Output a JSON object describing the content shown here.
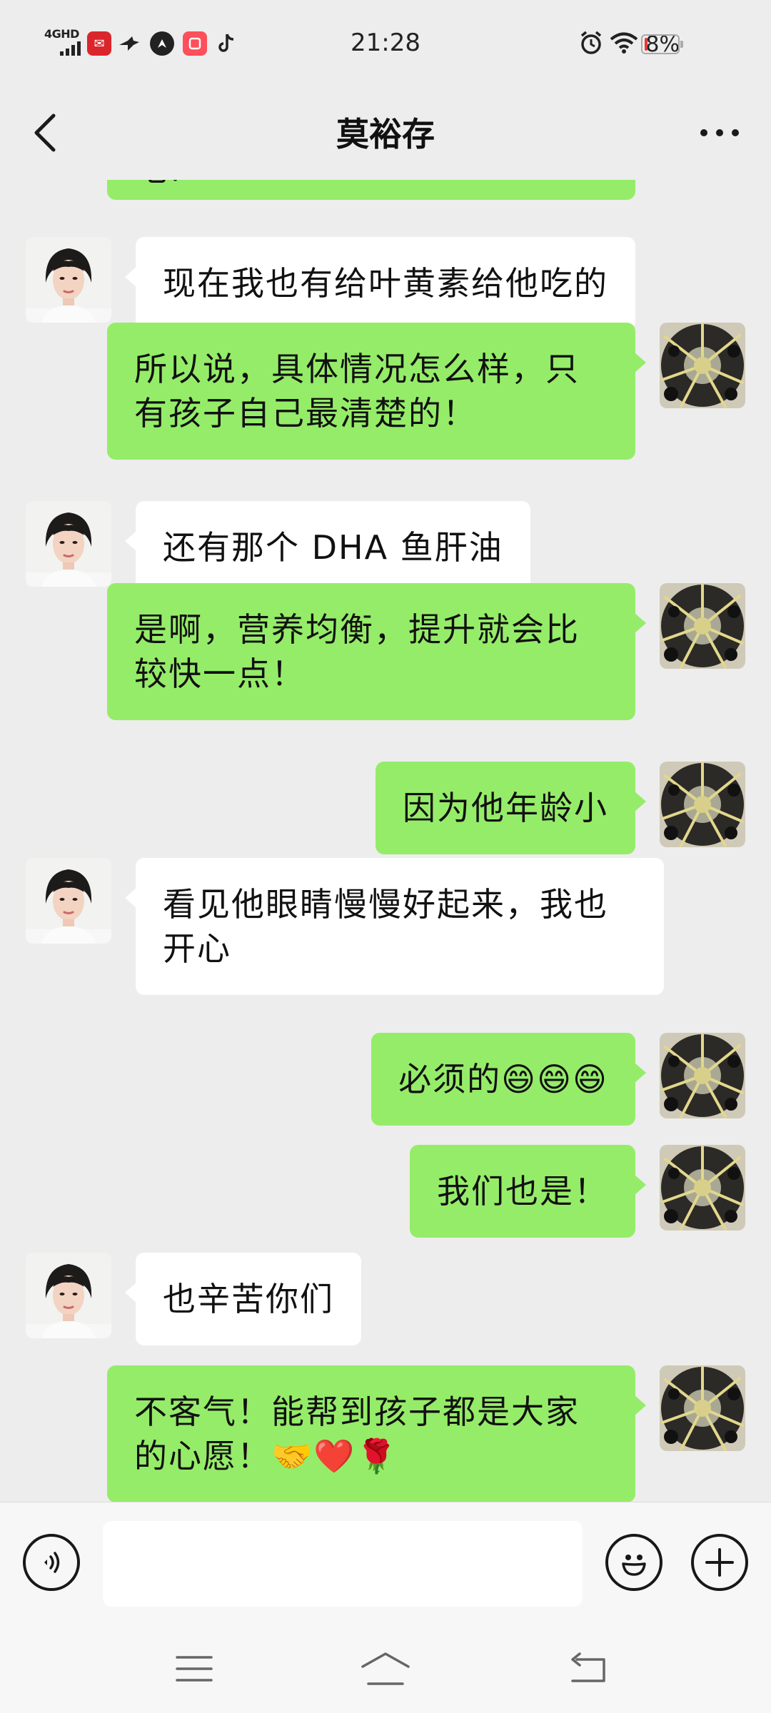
{
  "status_bar": {
    "network_label": "4GHD",
    "time": "21:28",
    "battery_percent": "8%",
    "battery_level": 0.08,
    "app_icons": [
      "mail-icon",
      "pigeon-icon",
      "compass-icon",
      "xiaohongshu-icon",
      "tiktok-icon"
    ],
    "right_icons": [
      "alarm-icon",
      "wifi-icon"
    ]
  },
  "header": {
    "title": "莫裕存",
    "back_icon": "chevron-left-icon",
    "more_icon": "more-dots-icon"
  },
  "messages": [
    {
      "from": "me",
      "text": "吧！",
      "partial": true
    },
    {
      "from": "contact",
      "text": "现在我也有给叶黄素给他吃的"
    },
    {
      "from": "me",
      "text": "所以说，具体情况怎么样，只有孩子自己最清楚的！"
    },
    {
      "from": "contact",
      "text": "还有那个 DHA 鱼肝油"
    },
    {
      "from": "me",
      "text": "是啊，营养均衡，提升就会比较快一点！"
    },
    {
      "from": "me",
      "text": "因为他年龄小"
    },
    {
      "from": "contact",
      "text": "看见他眼睛慢慢好起来，我也开心"
    },
    {
      "from": "me",
      "text": "必须的😄😄😄"
    },
    {
      "from": "me",
      "text": "我们也是！"
    },
    {
      "from": "contact",
      "text": "也辛苦你们"
    },
    {
      "from": "me",
      "text": "不客气！能帮到孩子都是大家的心愿！🤝❤️🌹"
    }
  ],
  "input_bar": {
    "placeholder": "",
    "value": "",
    "voice_icon": "voice-icon",
    "emoji_icon": "emoji-icon",
    "plus_icon": "plus-icon"
  },
  "system_nav": [
    "menu-icon",
    "home-icon",
    "back-icon"
  ],
  "colors": {
    "background": "#ededed",
    "sent_bubble": "#95ec69",
    "received_bubble": "#ffffff",
    "battery_low": "#e53935"
  }
}
